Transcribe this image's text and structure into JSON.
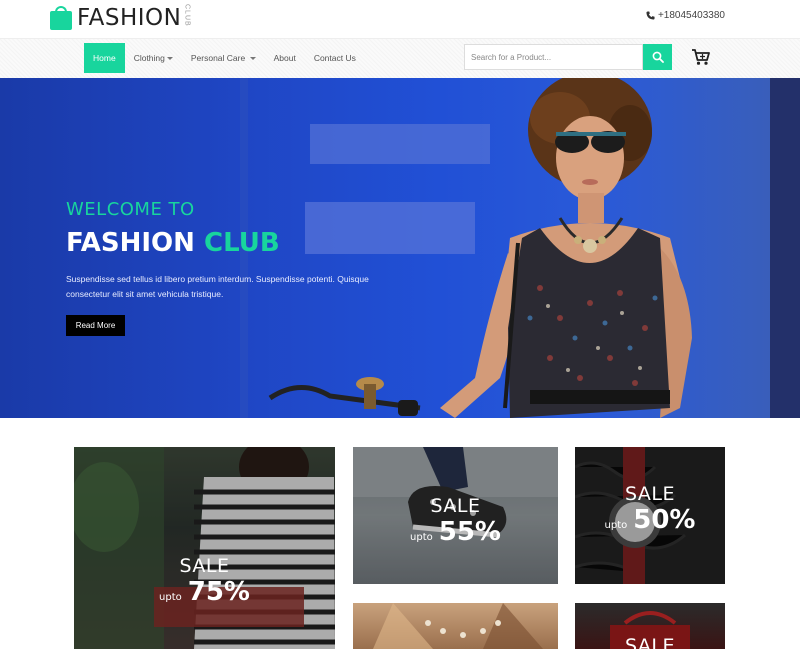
{
  "header": {
    "brand": "FASHION",
    "brand_sub": "CLUB",
    "phone": "+18045403380"
  },
  "nav": {
    "items": [
      {
        "label": "Home",
        "active": true,
        "dropdown": false
      },
      {
        "label": "Clothing",
        "active": false,
        "dropdown": true
      },
      {
        "label": "Personal Care",
        "active": false,
        "dropdown": true
      },
      {
        "label": "About",
        "active": false,
        "dropdown": false
      },
      {
        "label": "Contact Us",
        "active": false,
        "dropdown": false
      }
    ],
    "search_placeholder": "Search for a Product...",
    "search_icon": "search-icon",
    "cart_icon": "cart-icon"
  },
  "hero": {
    "welcome": "WELCOME TO",
    "title_main": "FASHION",
    "title_accent": "CLUB",
    "text": "Suspendisse sed tellus id libero pretium interdum. Suspendisse potenti. Quisque consectetur elit sit amet vehicula tristique.",
    "button": "Read More"
  },
  "promos": [
    {
      "sale": "SALE",
      "upto": "upto",
      "percent": "75%"
    },
    {
      "sale": "SALE",
      "upto": "upto",
      "percent": "55%"
    },
    {
      "sale": "SALE",
      "upto": "upto",
      "percent": "50%"
    },
    {
      "sale": "SALE"
    }
  ],
  "colors": {
    "accent": "#18d59d",
    "hero_blue": "#2150d6",
    "button_dark": "#000000"
  }
}
